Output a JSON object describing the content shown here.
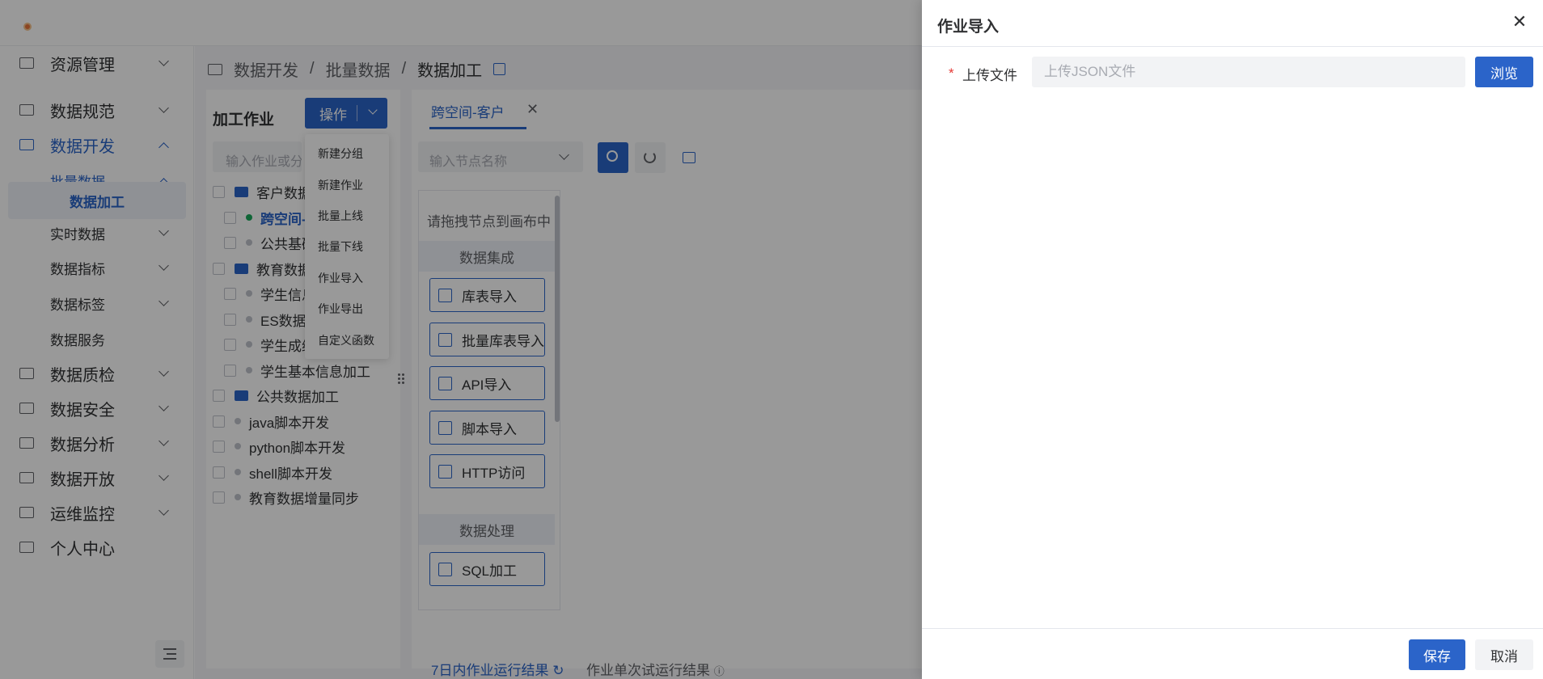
{
  "sidebar": {
    "items": [
      {
        "label": "资源管理"
      },
      {
        "label": "数据规范"
      },
      {
        "label": "数据开发"
      },
      {
        "label": "批量数据"
      },
      {
        "label": "数据加工"
      },
      {
        "label": "实时数据"
      },
      {
        "label": "数据指标"
      },
      {
        "label": "数据标签"
      },
      {
        "label": "数据服务"
      },
      {
        "label": "数据质检"
      },
      {
        "label": "数据安全"
      },
      {
        "label": "数据分析"
      },
      {
        "label": "数据开放"
      },
      {
        "label": "运维监控"
      },
      {
        "label": "个人中心"
      }
    ]
  },
  "breadcrumb": [
    "数据开发",
    "/",
    "批量数据",
    "/",
    "数据加工"
  ],
  "left_panel": {
    "title": "加工作业",
    "op_button": "操作",
    "search_placeholder": "输入作业或分组名称",
    "tree": [
      {
        "label": "客户数据加工"
      },
      {
        "label": "跨空间-客户"
      },
      {
        "label": "公共基础数据"
      },
      {
        "label": "教育数据加工"
      },
      {
        "label": "学生信息加工"
      },
      {
        "label": "ES数据加工"
      },
      {
        "label": "学生成绩信息加工"
      },
      {
        "label": "学生基本信息加工"
      },
      {
        "label": "公共数据加工"
      },
      {
        "label": "java脚本开发"
      },
      {
        "label": "python脚本开发"
      },
      {
        "label": "shell脚本开发"
      },
      {
        "label": "教育数据增量同步"
      }
    ]
  },
  "op_menu": [
    "新建分组",
    "新建作业",
    "批量上线",
    "批量下线",
    "作业导入",
    "作业导出",
    "自定义函数"
  ],
  "editor": {
    "tab": "跨空间-客户",
    "tab_close": "✕",
    "node_search_placeholder": "输入节点名称",
    "palette_hint": "请拖拽节点到画布中",
    "section_integration": "数据集成",
    "integration_nodes": [
      "库表导入",
      "批量库表导入",
      "API导入",
      "脚本导入",
      "HTTP访问"
    ],
    "section_processing": "数据处理",
    "processing_nodes": [
      "SQL加工"
    ],
    "bottom_tab_1": "7日内作业运行结果",
    "bottom_tab_2": "作业单次试运行结果"
  },
  "drawer": {
    "title": "作业导入",
    "close": "✕",
    "required_mark": "*",
    "field_label": "上传文件",
    "file_placeholder": "上传JSON文件",
    "browse_button": "浏览",
    "save_button": "保存",
    "cancel_button": "取消"
  },
  "colors": {
    "accent": "#2b64c9",
    "required": "#e53935",
    "overlay": "rgba(0,0,0,0.4)"
  }
}
